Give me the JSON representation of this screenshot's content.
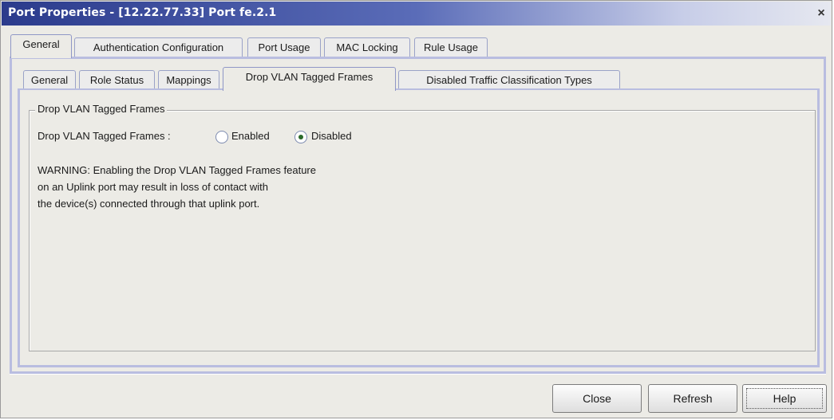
{
  "window": {
    "title": "Port Properties - [12.22.77.33] Port fe.2.1",
    "close_glyph": "×"
  },
  "top_tabs": [
    {
      "label": "General",
      "active": true
    },
    {
      "label": "Authentication Configuration",
      "active": false
    },
    {
      "label": "Port Usage",
      "active": false
    },
    {
      "label": "MAC Locking",
      "active": false
    },
    {
      "label": "Rule Usage",
      "active": false
    }
  ],
  "sub_tabs": [
    {
      "label": "General",
      "active": false
    },
    {
      "label": "Role Status",
      "active": false
    },
    {
      "label": "Mappings",
      "active": false
    },
    {
      "label": "Drop VLAN Tagged Frames",
      "active": true
    },
    {
      "label": "Disabled Traffic Classification Types",
      "active": false
    }
  ],
  "group": {
    "title": "Drop VLAN Tagged Frames",
    "field_label": "Drop VLAN Tagged Frames :",
    "options": [
      {
        "label": "Enabled",
        "checked": false
      },
      {
        "label": "Disabled",
        "checked": true
      }
    ],
    "warning_lines": [
      "WARNING: Enabling the Drop VLAN Tagged Frames feature",
      "on an Uplink port may result in loss of contact with",
      "the device(s) connected through that uplink port."
    ]
  },
  "buttons": {
    "close": "Close",
    "refresh": "Refresh",
    "help": "Help"
  },
  "colors": {
    "title_bar_start": "#2b3b8c",
    "title_bar_end": "#e6e8f0",
    "tab_border": "#9aa2c8",
    "radio_dot": "#2a6a2a"
  },
  "icons": {
    "window_close": "close-icon",
    "radio_enabled": "radio-unchecked-icon",
    "radio_disabled": "radio-checked-icon"
  }
}
